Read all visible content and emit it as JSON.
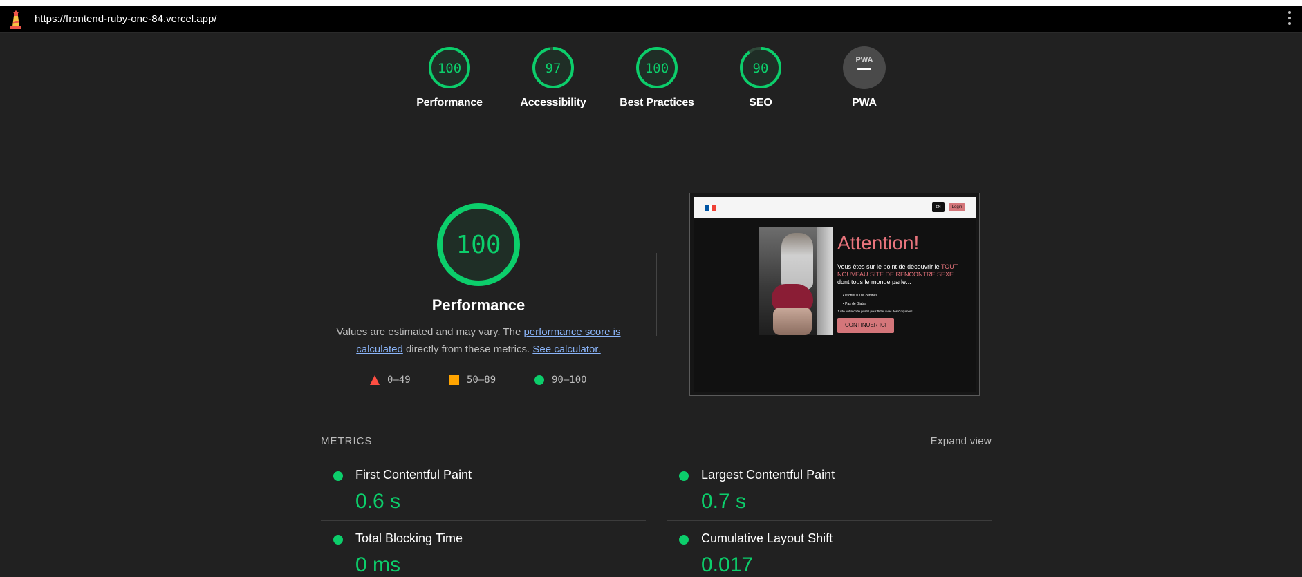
{
  "browser": {
    "url": "https://frontend-ruby-one-84.vercel.app/"
  },
  "categories": [
    {
      "label": "Performance",
      "score": "100",
      "value": 100,
      "color": "#0cce6b"
    },
    {
      "label": "Accessibility",
      "score": "97",
      "value": 97,
      "color": "#0cce6b"
    },
    {
      "label": "Best Practices",
      "score": "100",
      "value": 100,
      "color": "#0cce6b"
    },
    {
      "label": "SEO",
      "score": "90",
      "value": 90,
      "color": "#0cce6b"
    },
    {
      "label": "PWA",
      "badge": "PWA",
      "value": null,
      "color": "#9e9e9e"
    }
  ],
  "performance": {
    "score": "100",
    "value": 100,
    "title": "Performance",
    "desc_pre": "Values are estimated and may vary. The ",
    "desc_link1": "performance score is calculated",
    "desc_mid": " directly from these metrics. ",
    "desc_link2": "See calculator.",
    "legend": [
      {
        "shape": "triangle",
        "range": "0–49",
        "color": "#ff4e42"
      },
      {
        "shape": "square",
        "range": "50–89",
        "color": "#ffa400"
      },
      {
        "shape": "circle",
        "range": "90–100",
        "color": "#0cce6b"
      }
    ]
  },
  "screenshot": {
    "lang_button": "EN",
    "login_button": "Login",
    "heading": "Attention!",
    "text_pre": "Vous êtes sur le point de découvrir le ",
    "text_pink": "TOUT NOUVEAU SITE DE RENCONTRE SEXE",
    "text_post": " dont tous le monde parle...",
    "bullets": [
      "Profils 100% certifiés",
      "Pas de Blabla"
    ],
    "small_text": "Juste votre code postal pour flirter avec des Coquines!",
    "cta": "CONTINUER ICI"
  },
  "metrics": {
    "title": "METRICS",
    "expand_label": "Expand view",
    "items": [
      {
        "name": "First Contentful Paint",
        "value": "0.6 s"
      },
      {
        "name": "Largest Contentful Paint",
        "value": "0.7 s"
      },
      {
        "name": "Total Blocking Time",
        "value": "0 ms"
      },
      {
        "name": "Cumulative Layout Shift",
        "value": "0.017"
      }
    ]
  },
  "colors": {
    "pass": "#0cce6b",
    "link": "#8ab4f8",
    "background": "#212121"
  }
}
